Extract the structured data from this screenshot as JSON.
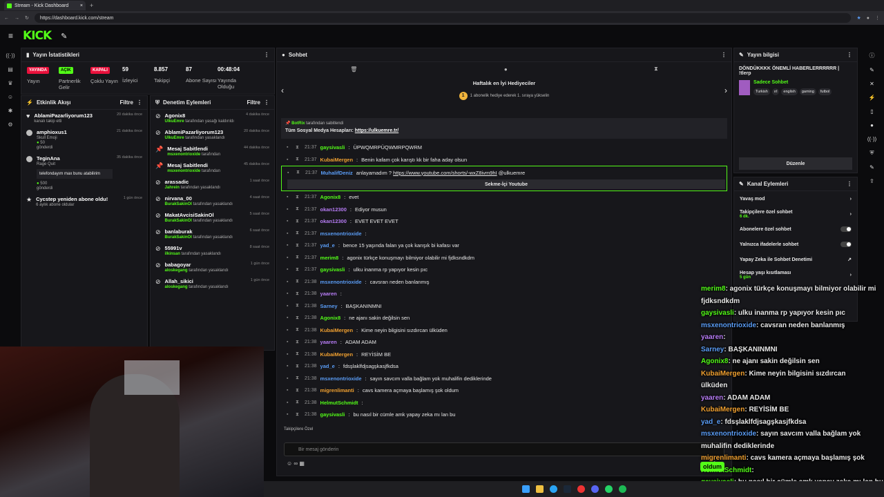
{
  "browser": {
    "tab_title": "Stream - Kick Dashboard",
    "url": "https://dashboard.kick.com/stream"
  },
  "header": {
    "logo": "KICK"
  },
  "stats": {
    "title": "Yayın İstatistikleri",
    "items": [
      {
        "badge": "YAYINDA",
        "badge_color": "#e9113c",
        "label": "Yayın"
      },
      {
        "badge": "AÇIK",
        "badge_color": "#53fc18",
        "label": "Partnerlik Gelir"
      },
      {
        "badge": "KAPALI",
        "badge_color": "#e9113c",
        "label": "Çoklu Yayın"
      },
      {
        "value": "59",
        "label": "İzleyici"
      },
      {
        "value": "8.857",
        "label": "Takipçi"
      },
      {
        "value": "87",
        "label": "Abone Sayısı"
      },
      {
        "value": "00:48:04",
        "label": "Yayında Olduğu"
      }
    ]
  },
  "activity": {
    "title": "Etkinlik Akışı",
    "filter": "Filtre",
    "items": [
      {
        "name": "AblamiPazarliyorum123",
        "sub": "kanalı takip etti",
        "time": "20 dakika önce"
      },
      {
        "name": "amphioxus1",
        "sub": "Skull Emoji",
        "extra": "50",
        "extra2": "gönderdi",
        "time": "21 dakika önce"
      },
      {
        "name": "TeginAna",
        "sub": "Rage Quit",
        "msg": "telefondayım max bunu atabilirim",
        "extra": "500",
        "extra2": "gönderdi",
        "time": "35 dakika önce"
      },
      {
        "name": "Cycstep yeniden abone oldu!",
        "sub": "6 aylık abone oldular",
        "time": "1 gün önce"
      }
    ]
  },
  "modlog": {
    "title": "Denetim Eylemleri",
    "filter": "Filtre",
    "items": [
      {
        "name": "Agonix8",
        "by": "UlkuEmre",
        "sub": "tarafından yasağı kaldırıldı",
        "time": "4 dakika önce"
      },
      {
        "name": "AblamiPazarliyorum123",
        "by": "UlkuEmre",
        "sub": "tarafından yasaklandı",
        "time": "20 dakika önce"
      },
      {
        "name": "Mesaj Sabitlendi",
        "by": "msxenontrioxide",
        "sub": "tarafından",
        "time": "44 dakika önce"
      },
      {
        "name": "Mesaj Sabitlendi",
        "by": "msxenontrioxide",
        "sub": "tarafından",
        "time": "45 dakika önce"
      },
      {
        "name": "arassadic",
        "by": "Jahrein",
        "sub": "tarafından yasaklandı",
        "time": "1 saat önce"
      },
      {
        "name": "nirvana_00",
        "by": "BurakSakinOl",
        "sub": "tarafından yasaklandı",
        "time": "4 saat önce"
      },
      {
        "name": "MakatAvcisiSakinOl",
        "by": "BurakSakinOl",
        "sub": "tarafından yasaklandı",
        "time": "5 saat önce"
      },
      {
        "name": "banlaburak",
        "by": "BurakSakinOl",
        "sub": "tarafından yasaklandı",
        "time": "6 saat önce"
      },
      {
        "name": "55991v",
        "by": "ilkinsan",
        "sub": "tarafından yasaklandı",
        "time": "8 saat önce"
      },
      {
        "name": "babagoyar",
        "by": "aloskegang",
        "sub": "tarafından yasaklandı",
        "time": "1 gün önce"
      },
      {
        "name": "Allah_sikici",
        "by": "aloskegang",
        "sub": "tarafından yasaklandı",
        "time": "1 gün önce"
      }
    ]
  },
  "chat": {
    "title": "Sohbet",
    "gifters_title": "Haftalık en İyi Hediyeciler",
    "gifters_sub": "1 abonelik hediye ederek 1. sıraya yükselin",
    "medal": "1",
    "pinned": {
      "by": "BotRix",
      "by_sub": "tarafından sabitlendi",
      "text": "Tüm Sosyal Medya Hesapları:",
      "link": "https://ulkuemre.tr/"
    },
    "messages": [
      {
        "time": "21:37",
        "user": "gaysivasli",
        "color": "#53fc18",
        "text": "ÜPWQMRPÜQWMRPQWRM"
      },
      {
        "time": "21:37",
        "user": "KubaiMergen",
        "color": "#f0a030",
        "text": "Benin kafam çok karıştı kk bir faha aday olsun"
      }
    ],
    "highlight": {
      "time": "21:37",
      "user": "MuhalifDeniz",
      "color": "#5a9cf5",
      "text": "anlayamadım ? ",
      "link": "https://www.youtube.com/shorts/-wxZ8ivm9hI",
      "mention": " @ulkuemre",
      "button": "Sekme-İçi Youtube"
    },
    "messages2": [
      {
        "time": "21:37",
        "user": "Agonix8",
        "color": "#53fc18",
        "text": "evet"
      },
      {
        "time": "21:37",
        "user": "okan12300",
        "color": "#b77cf5",
        "text": "Ediyor musun"
      },
      {
        "time": "21:37",
        "user": "okan12300",
        "color": "#b77cf5",
        "text": "EVET EVET EVET"
      },
      {
        "time": "21:37",
        "user": "msxenontrioxide",
        "color": "#5a9cf5",
        "text": ""
      },
      {
        "time": "21:37",
        "user": "yad_e",
        "color": "#5a9cf5",
        "text": "bence 15 yaşında falan ya çok karışık bi kafası var"
      },
      {
        "time": "21:37",
        "user": "merim8",
        "color": "#53fc18",
        "text": "agonix türkçe konuşmayı bilmiyor olabilir mi fjdksndkdm"
      },
      {
        "time": "21:37",
        "user": "gaysivasli",
        "color": "#53fc18",
        "text": "ulku inanma rp yapıyor kesin pıc"
      },
      {
        "time": "21:38",
        "user": "msxenontrioxide",
        "color": "#5a9cf5",
        "text": "cavsran neden banlanmış"
      },
      {
        "time": "21:38",
        "user": "yaaren",
        "color": "#b77cf5",
        "text": ""
      },
      {
        "time": "21:38",
        "user": "Sarney",
        "color": "#5a9cf5",
        "text": "BAŞKANINMNI"
      },
      {
        "time": "21:38",
        "user": "Agonix8",
        "color": "#53fc18",
        "text": "ne ajanı sakin değilsin sen"
      },
      {
        "time": "21:38",
        "user": "KubaiMergen",
        "color": "#f0a030",
        "text": "Kime neyin bilgisini sızdırcan ülküden"
      },
      {
        "time": "21:38",
        "user": "yaaren",
        "color": "#b77cf5",
        "text": "ADAM ADAM"
      },
      {
        "time": "21:38",
        "user": "KubaiMergen",
        "color": "#f0a030",
        "text": "REYİSİM BE"
      },
      {
        "time": "21:38",
        "user": "yad_e",
        "color": "#5a9cf5",
        "text": "fdsşlaklfdjsagşkasjfkdsa"
      },
      {
        "time": "21:38",
        "user": "msxenontrioxide",
        "color": "#5a9cf5",
        "text": "sayın savcım valla bağlam yok muhalifin dediklerinde"
      },
      {
        "time": "21:38",
        "user": "migrenlimanti",
        "color": "#f0a030",
        "text": "cavs kamera açmaya başlamış şok oldum"
      },
      {
        "time": "21:38",
        "user": "HelmutSchmidt",
        "color": "#53fc18",
        "text": ""
      },
      {
        "time": "21:38",
        "user": "gaysivasli",
        "color": "#53fc18",
        "text": "bu nasıl bir cümle amk yapay zeka mı lan bu"
      }
    ],
    "followers_label": "Takipçilere Özel",
    "compose_placeholder": "Bir mesaj gönderin"
  },
  "info": {
    "title": "Yayın bilgisi",
    "stream_title": "DÖNDÜKKKK ÖNEMLİ HABERLERRRRRR | !tlerp",
    "category": "Sadece Sohbet",
    "tags": [
      "Turkish",
      "ırl",
      "english",
      "gaming",
      "futbol"
    ],
    "edit_button": "Düzenle"
  },
  "actions": {
    "title": "Kanal Eylemleri",
    "items": [
      {
        "label": "Yavaş mod",
        "kind": "chevron"
      },
      {
        "label": "Takipçilere özel sohbet",
        "sub": "6 dk.",
        "kind": "chevron"
      },
      {
        "label": "Abonelere özel sohbet",
        "kind": "toggle"
      },
      {
        "label": "Yalnızca ifadelerle sohbet",
        "kind": "toggle"
      },
      {
        "label": "Yapay Zeka ile Sohbet Denetimi",
        "kind": "link"
      },
      {
        "label": "Hesap yaşı kısıtlaması",
        "sub": "5 gün",
        "kind": "chevron"
      }
    ]
  },
  "overlay": {
    "lines": [
      {
        "user": "merim8",
        "color": "#53fc18",
        "text": ": agonix türkçe konuşmayı bilmiyor olabilir mi"
      },
      {
        "user": "",
        "color": "#fff",
        "text": "fjdksndkdm"
      },
      {
        "user": "gaysivasli",
        "color": "#53fc18",
        "text": ": ulku inanma rp yapıyor kesin pıc"
      },
      {
        "user": "msxenontrioxide",
        "color": "#5a9cf5",
        "text": ": cavsran neden banlanmış"
      },
      {
        "user": "yaaren",
        "color": "#b77cf5",
        "text": ":"
      },
      {
        "user": "Sarney",
        "color": "#5a9cf5",
        "text": ": BAŞKANINMNI"
      },
      {
        "user": "Agonix8",
        "color": "#53fc18",
        "text": ": ne ajanı sakin değilsin sen"
      },
      {
        "user": "KubaiMergen",
        "color": "#f0a030",
        "text": ": Kime neyin bilgisini sızdırcan"
      },
      {
        "user": "",
        "color": "#fff",
        "text": "ülküden"
      },
      {
        "user": "yaaren",
        "color": "#b77cf5",
        "text": ": ADAM ADAM"
      },
      {
        "user": "KubaiMergen",
        "color": "#f0a030",
        "text": ": REYİSİM BE"
      },
      {
        "user": "yad_e",
        "color": "#5a9cf5",
        "text": ": fdsşlaklfdjsagşkasjfkdsa"
      },
      {
        "user": "msxenontrioxide",
        "color": "#5a9cf5",
        "text": ": sayın savcım valla bağlam yok"
      },
      {
        "user": "",
        "color": "#fff",
        "text": "muhalifin dediklerinde"
      },
      {
        "user": "migrenlimanti",
        "color": "#f0a030",
        "text": ": cavs kamera açmaya başlamış şok"
      },
      {
        "user": "",
        "color": "#fff",
        "text": ""
      },
      {
        "user": "HelmutSchmidt",
        "color": "#53fc18",
        "text": ":"
      },
      {
        "user": "gaysivasli",
        "color": "#53fc18",
        "text": ": bu nasıl bir cümle amk yapay zeka mı lan bu"
      }
    ],
    "badge": "oldum"
  }
}
